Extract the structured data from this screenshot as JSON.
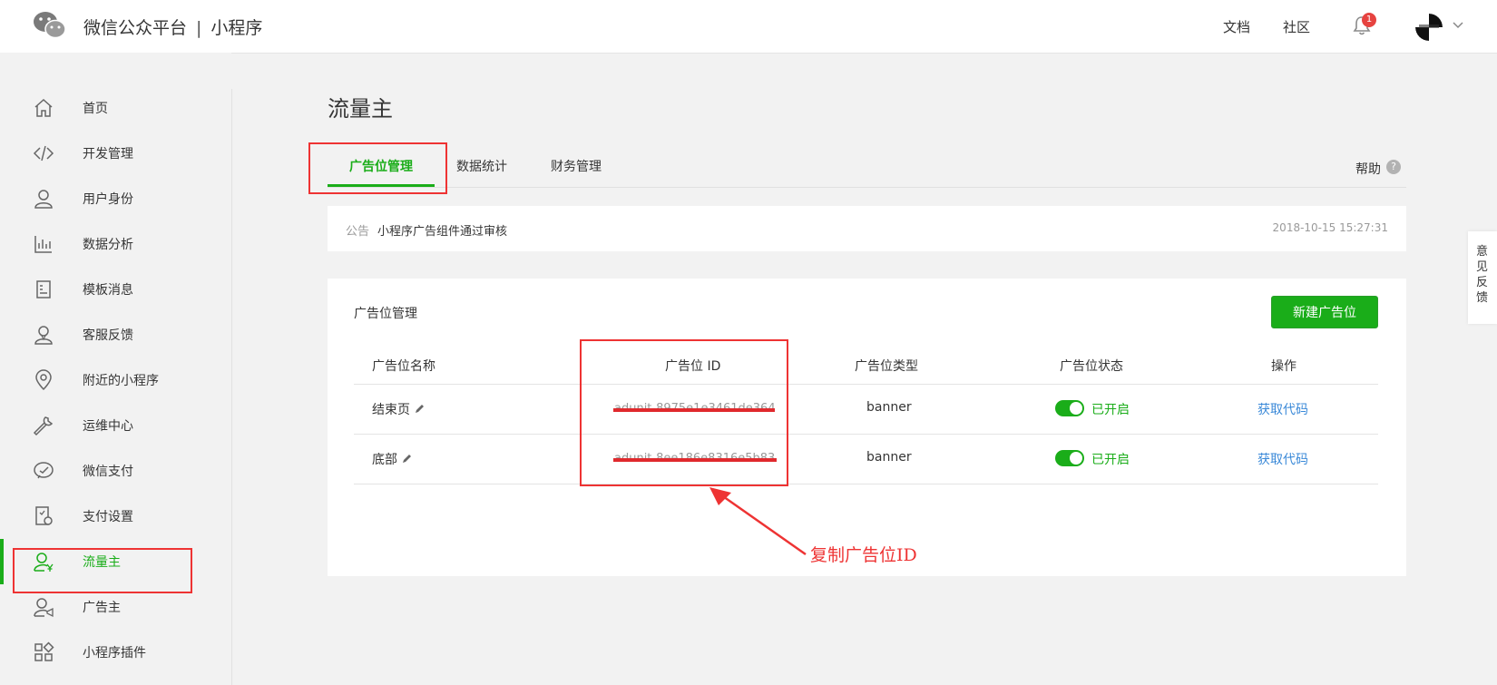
{
  "header": {
    "brand_name": "微信公众平台",
    "separator": "|",
    "product": "小程序",
    "docs": "文档",
    "community": "社区",
    "notification_count": "1"
  },
  "sidebar": {
    "items": [
      {
        "label": "首页",
        "icon": "home-icon"
      },
      {
        "label": "开发管理",
        "icon": "code-icon"
      },
      {
        "label": "用户身份",
        "icon": "user-icon"
      },
      {
        "label": "数据分析",
        "icon": "chart-icon"
      },
      {
        "label": "模板消息",
        "icon": "document-icon"
      },
      {
        "label": "客服反馈",
        "icon": "support-icon"
      },
      {
        "label": "附近的小程序",
        "icon": "location-icon"
      },
      {
        "label": "运维中心",
        "icon": "wrench-icon"
      },
      {
        "label": "微信支付",
        "icon": "pay-icon"
      },
      {
        "label": "支付设置",
        "icon": "pay-settings-icon"
      },
      {
        "label": "流量主",
        "icon": "publisher-icon",
        "active": true
      },
      {
        "label": "广告主",
        "icon": "advertiser-icon"
      },
      {
        "label": "小程序插件",
        "icon": "plugin-icon"
      }
    ]
  },
  "main": {
    "title": "流量主",
    "tabs": [
      {
        "label": "广告位管理",
        "active": true
      },
      {
        "label": "数据统计"
      },
      {
        "label": "财务管理"
      }
    ],
    "help": "帮助",
    "help_icon_glyph": "?"
  },
  "notice": {
    "tag": "公告",
    "text": "小程序广告组件通过审核",
    "time": "2018-10-15 15:27:31"
  },
  "ad_card": {
    "title": "广告位管理",
    "new_button": "新建广告位",
    "columns": [
      "广告位名称",
      "广告位 ID",
      "广告位类型",
      "广告位状态",
      "操作"
    ],
    "rows": [
      {
        "name": "结束页",
        "id": "adunit-8975e1e3461de364",
        "type": "banner",
        "status": "已开启",
        "action": "获取代码"
      },
      {
        "name": "底部",
        "id": "adunit-8ee186e8316e5b83",
        "type": "banner",
        "status": "已开启",
        "action": "获取代码"
      }
    ]
  },
  "annotation": {
    "text": "复制广告位ID",
    "color": "#e33333"
  },
  "feedback": {
    "label": "意见反馈"
  },
  "colors": {
    "accent": "#1aad19",
    "link": "#3a89d8",
    "danger": "#e64340"
  }
}
